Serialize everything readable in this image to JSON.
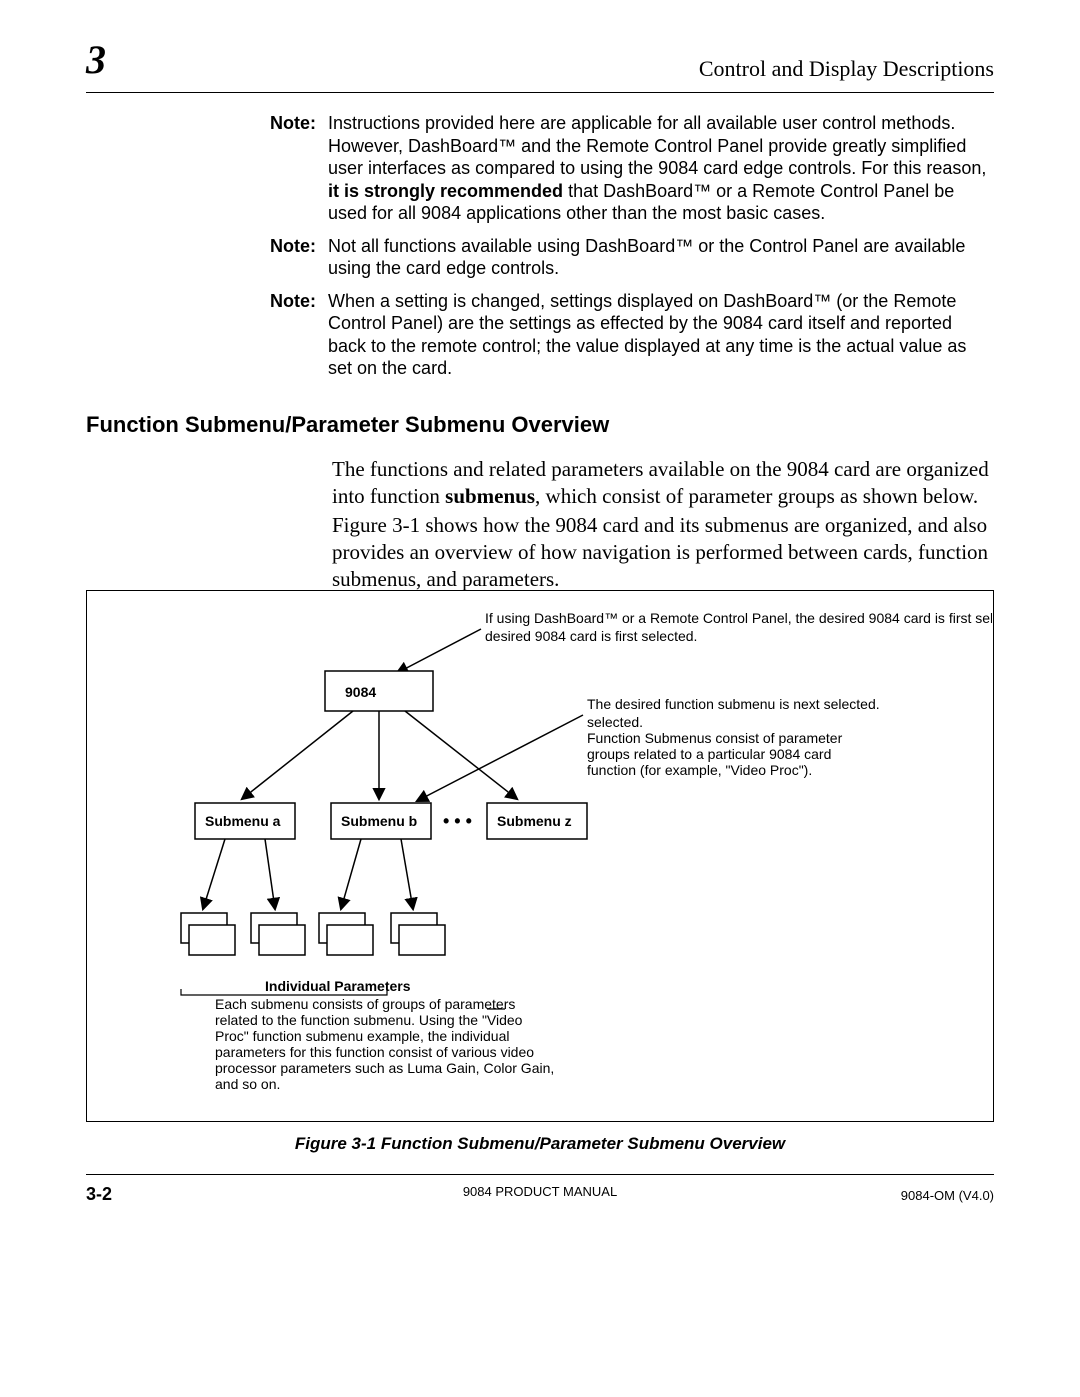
{
  "chapter_number": "3",
  "header_right": "Control and Display Descriptions",
  "notes": [
    {
      "label": "Note:",
      "segments": [
        {
          "t": "Instructions provided here are applicable for all available user control methods. However, DashBoard™ and the Remote Control Panel provide greatly simplified user interfaces as compared to using the 9084 card edge controls. For this reason, "
        },
        {
          "t": "it is strongly recommended",
          "b": true
        },
        {
          "t": " that DashBoard™ or a Remote Control Panel be used for all 9084 applications other than the most basic cases."
        }
      ]
    },
    {
      "label": "Note:",
      "segments": [
        {
          "t": "Not all functions available using DashBoard™ or the Control Panel are available using the card edge controls."
        }
      ]
    },
    {
      "label": "Note:",
      "segments": [
        {
          "t": "When a setting is changed, settings displayed on DashBoard™ (or the Remote Control Panel) are the settings as effected by the 9084 card itself and reported back to the remote control; the value displayed at any time is the actual value as set on the card."
        }
      ]
    }
  ],
  "section_heading": "Function Submenu/Parameter Submenu Overview",
  "para1_segments": [
    {
      "t": "The functions and related parameters available on the 9084 card are organized into function "
    },
    {
      "t": "submenus",
      "b": true
    },
    {
      "t": ", which consist of parameter groups as shown below."
    }
  ],
  "para2": "Figure 3-1 shows how the 9084 card and its submenus are organized, and also provides an overview of how navigation is performed between cards, function submenus, and parameters.",
  "figure": {
    "top_line_bold": "If using DashBoard™ or a Remote Control Panel",
    "top_line_rest": ", the desired 9084 card is first selected.",
    "card_label": "9084",
    "right_line1a": "The desired function ",
    "right_line1b": "submenu",
    "right_line1c": " is next selected.",
    "right_line2a": "Function ",
    "right_line2b": "Submenus",
    "right_line2c": " consist of parameter groups related to a particular 9084 card function (for example, \"Video Proc\").",
    "sub_a": "Submenu a",
    "sub_b": "Submenu b",
    "sub_z": "Submenu z",
    "ellipsis": "• • •",
    "indiv_heading": "Individual Parameters",
    "indiv_body": "Each submenu consists of groups of parameters related to the function submenu. Using the \"Video Proc\" function submenu example, the individual parameters for this function consist of various video processor parameters such as Luma Gain, Color Gain, and so on."
  },
  "figure_caption": "Figure 3-1 Function Submenu/Parameter Submenu Overview",
  "footer_left": "3-2",
  "footer_center": "9084 PRODUCT MANUAL",
  "footer_right": "9084-OM (V4.0)"
}
